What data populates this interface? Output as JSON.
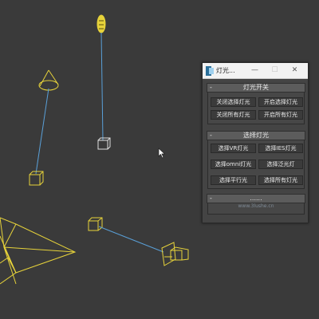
{
  "window": {
    "title": "灯光...",
    "minimize_glyph": "—",
    "maximize_glyph": "☐",
    "close_glyph": "✕"
  },
  "section_light_switch": {
    "collapse_glyph": "-",
    "title": "灯光开关",
    "buttons": [
      "关闭选择灯光",
      "开启选择灯光",
      "关闭所有灯光",
      "开启所有灯光"
    ]
  },
  "section_select_light": {
    "collapse_glyph": "-",
    "title": "选择灯光",
    "buttons": [
      "选择VR灯光",
      "选择IES灯光",
      "选择omni灯光",
      "选择泛光灯",
      "选择平行光",
      "选择所有灯光"
    ]
  },
  "section_more": {
    "collapse_glyph": "-",
    "dots": "......",
    "site": "www.3lushe.cn"
  },
  "colors": {
    "viewport_bg": "#3a3a3a",
    "light_wire": "#e6d23a",
    "target_line": "#5aa0d8",
    "target_box": "#e0e0e0",
    "panel_bg": "#444444"
  }
}
